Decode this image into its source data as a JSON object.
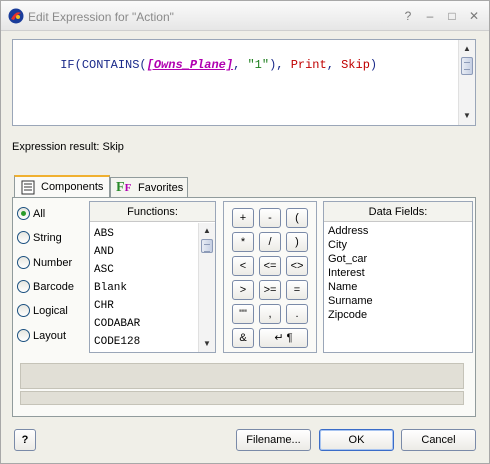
{
  "window": {
    "title": "Edit Expression for \"Action\"",
    "controls": [
      "?",
      "–",
      "□",
      "✕"
    ]
  },
  "expression": {
    "parts": [
      {
        "text": "IF(CONTAINS(",
        "color": "#1a2a8a"
      },
      {
        "text": "[Owns_Plane]",
        "color": "#b000b0"
      },
      {
        "text": ", ",
        "color": "#1a2a8a"
      },
      {
        "text": "\"1\"",
        "color": "#208020"
      },
      {
        "text": "), ",
        "color": "#1a2a8a"
      },
      {
        "text": "Print",
        "color": "#c00000"
      },
      {
        "text": ", ",
        "color": "#1a2a8a"
      },
      {
        "text": "Skip",
        "color": "#c00000"
      },
      {
        "text": ")",
        "color": "#1a2a8a"
      }
    ]
  },
  "result_text": "Expression result: Skip",
  "tabs": {
    "components": "Components",
    "favorites": "Favorites"
  },
  "categories": [
    "All",
    "String",
    "Number",
    "Barcode",
    "Logical",
    "Layout"
  ],
  "selected_category": "All",
  "functions": {
    "header": "Functions:",
    "items": [
      "ABS",
      "AND",
      "ASC",
      "Blank",
      "CHR",
      "CODABAR",
      "CODE128"
    ]
  },
  "operators": [
    "+",
    "-",
    "(",
    "*",
    "/",
    ")",
    "<",
    "<=",
    "<>",
    ">",
    ">=",
    "=",
    "\"\"",
    ",",
    ".",
    "&",
    "↵ ¶"
  ],
  "data_fields": {
    "header": "Data Fields:",
    "items": [
      "Address",
      "City",
      "Got_car",
      "Interest",
      "Name",
      "Surname",
      "Zipcode"
    ]
  },
  "buttons": {
    "help": "?",
    "filename": "Filename...",
    "ok": "OK",
    "cancel": "Cancel"
  },
  "colors": {
    "keyword": "#1a2a8a",
    "field": "#b000b0",
    "string": "#208020",
    "value": "#c00000"
  }
}
